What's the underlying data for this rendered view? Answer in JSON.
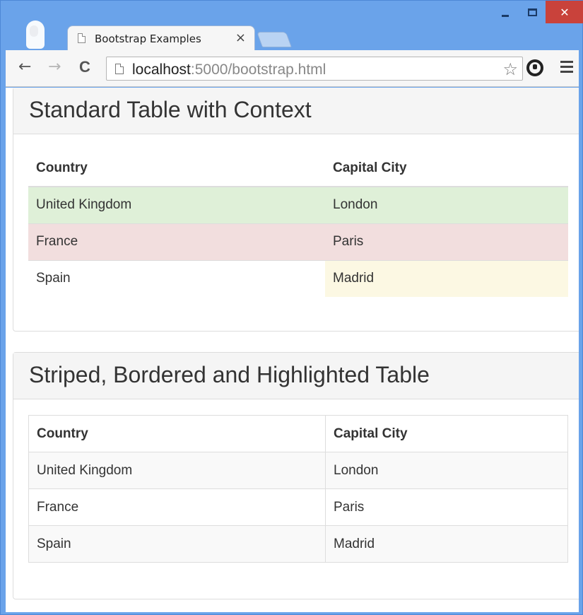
{
  "browser": {
    "tab_title": "Bootstrap Examples",
    "tab_close": "×",
    "url_host": "localhost",
    "url_rest": ":5000/bootstrap.html",
    "back_icon": "←",
    "forward_icon": "→",
    "reload_icon": "C",
    "star_icon": "☆",
    "close_glyph": "✕"
  },
  "panels": [
    {
      "title": "Standard Table with Context",
      "headers": [
        "Country",
        "Capital City"
      ],
      "rows": [
        [
          "United Kingdom",
          "London"
        ],
        [
          "France",
          "Paris"
        ],
        [
          "Spain",
          "Madrid"
        ]
      ]
    },
    {
      "title": "Striped, Bordered and Highlighted Table",
      "headers": [
        "Country",
        "Capital City"
      ],
      "rows": [
        [
          "United Kingdom",
          "London"
        ],
        [
          "France",
          "Paris"
        ],
        [
          "Spain",
          "Madrid"
        ]
      ]
    }
  ],
  "colors": {
    "success": "#dff0d8",
    "danger": "#f2dede",
    "warning": "#fcf8e3",
    "stripe": "#f9f9f9",
    "frame": "#6aa3ea"
  }
}
